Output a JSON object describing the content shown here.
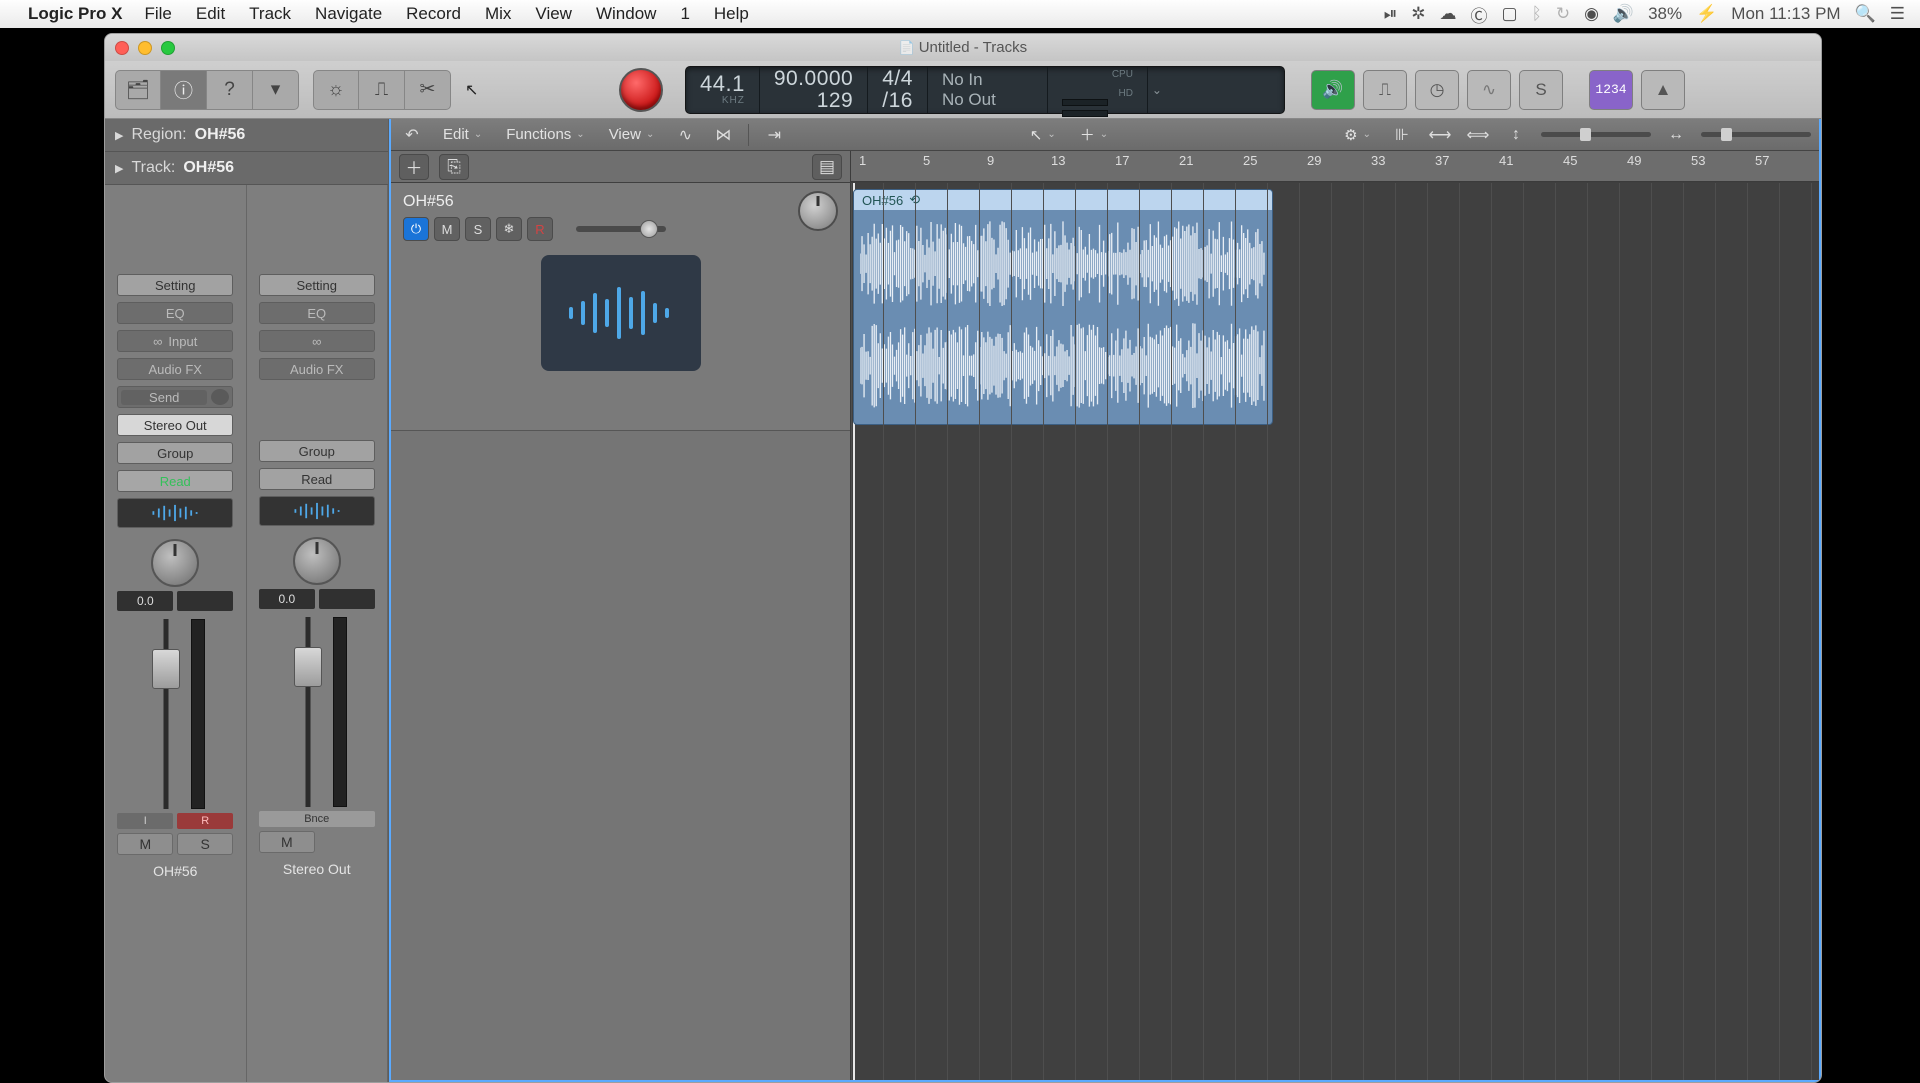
{
  "menubar": {
    "app": "Logic Pro X",
    "items": [
      "File",
      "Edit",
      "Track",
      "Navigate",
      "Record",
      "Mix",
      "View",
      "Window",
      "1",
      "Help"
    ],
    "battery": "38%",
    "clock": "Mon 11:13 PM"
  },
  "window": {
    "title": "Untitled - Tracks"
  },
  "lcd": {
    "sr": "44.1",
    "sr_unit": "KHZ",
    "tempo": "90.0000",
    "pos": "129",
    "sig_top": "4/4",
    "sig_bot": "/16",
    "io_in": "No In",
    "io_out": "No Out",
    "cpu": "CPU",
    "hd": "HD"
  },
  "purple": "1234",
  "inspector": {
    "region_label": "Region:",
    "region_name": "OH#56",
    "track_label": "Track:",
    "track_name": "OH#56",
    "ch": [
      {
        "setting": "Setting",
        "eq": "EQ",
        "input": "Input",
        "afx": "Audio FX",
        "send": "Send",
        "out": "Stereo Out",
        "group": "Group",
        "read": "Read",
        "db": "0.0",
        "ir_i": "I",
        "ir_r": "R",
        "m": "M",
        "s": "S",
        "name": "OH#56"
      },
      {
        "setting": "Setting",
        "eq": "EQ",
        "afx": "Audio FX",
        "group": "Group",
        "read": "Read",
        "db": "0.0",
        "bnce": "Bnce",
        "m": "M",
        "name": "Stereo Out"
      }
    ]
  },
  "main_tb": {
    "edit": "Edit",
    "functions": "Functions",
    "view": "View"
  },
  "ruler": {
    "nums": [
      "1",
      "5",
      "9",
      "13",
      "17",
      "21",
      "25",
      "29",
      "33",
      "37",
      "41",
      "45",
      "49",
      "53",
      "57"
    ]
  },
  "track": {
    "name": "OH#56",
    "m": "M",
    "s": "S"
  },
  "region": {
    "name": "OH#56"
  }
}
